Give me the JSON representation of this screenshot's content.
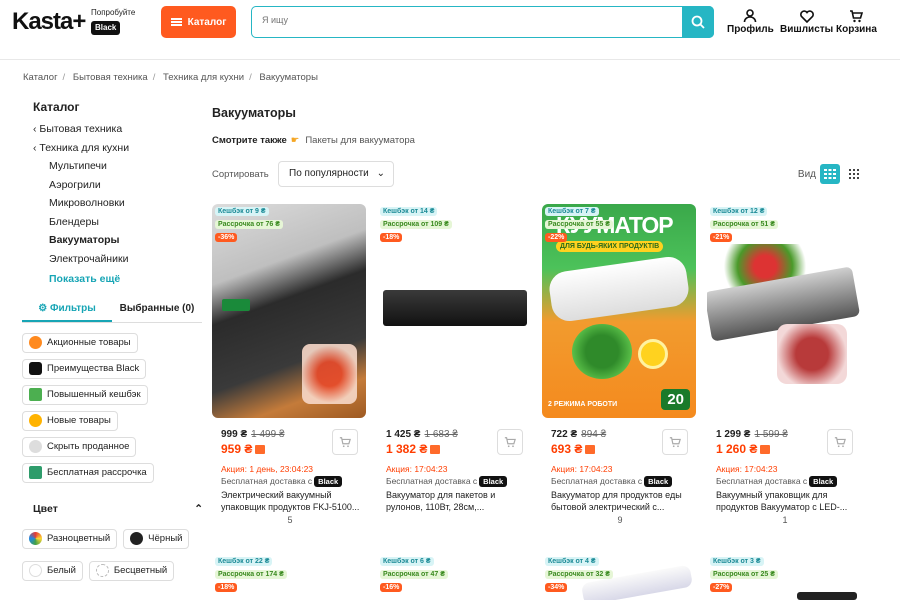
{
  "header": {
    "logo": "Kasta+",
    "promo_try": "Попробуйте",
    "promo_badge": "Black",
    "catalog_btn": "Каталог",
    "search_placeholder": "Я ищу",
    "profile": "Профиль",
    "wishlist": "Вишлисты",
    "cart": "Корзина",
    "accent": "#26b6c4",
    "orange": "#ff5a1f"
  },
  "breadcrumbs": [
    "Каталог",
    "Бытовая техника",
    "Техника для кухни",
    "Вакууматоры"
  ],
  "sidebar": {
    "title": "Каталог",
    "tree": [
      {
        "label": "Бытовая техника"
      },
      {
        "label": "Техника для кухни"
      }
    ],
    "children": [
      "Мультипечи",
      "Аэрогрили",
      "Микроволновки",
      "Блендеры",
      "Вакууматоры",
      "Электрочайники"
    ],
    "show_more": "Показать ещё",
    "tab_filters": "Фильтры",
    "tab_selected": "Выбранные (0)",
    "chips": [
      "Акционные товары",
      "Преимущества Black",
      "Повышенный кешбэк",
      "Новые товары",
      "Скрыть проданное",
      "Бесплатная рассрочка"
    ],
    "color_title": "Цвет",
    "colors": [
      "Разноцветный",
      "Чёрный",
      "Белый",
      "Бесцветный"
    ]
  },
  "main": {
    "title": "Вакууматоры",
    "see_also_label": "Смотрите также",
    "see_also_link": "Пакеты для вакууматора",
    "sort_label": "Сортировать",
    "sort_value": "По популярности",
    "view_label": "Вид"
  },
  "products": [
    {
      "cashback": "Кешбэк от 9 ₴",
      "installment": "Рассрочка от 76 ₴",
      "discount": "-36%",
      "old_price": "999 ₴",
      "old_strike": "1 499 ₴",
      "new_price": "959 ₴",
      "promo": "Акция: 1 день, 23:04:23",
      "delivery": "Бесплатная доставка с",
      "delivery_badge": "Black",
      "name": "Электрический вакуумный упаковщик продуктов FKJ-5100...",
      "reviews": "5"
    },
    {
      "cashback": "Кешбэк от 14 ₴",
      "installment": "Рассрочка от 109 ₴",
      "discount": "-18%",
      "old_price": "1 425 ₴",
      "old_strike": "1 683 ₴",
      "new_price": "1 382 ₴",
      "promo": "Акция: 17:04:23",
      "delivery": "Бесплатная доставка с",
      "delivery_badge": "Black",
      "name": "Вакууматор для пакетов и рулонов, 110Вт, 28см,...",
      "reviews": ""
    },
    {
      "cashback": "Кешбэк от 7 ₴",
      "installment": "Рассрочка от 55 ₴",
      "discount": "-22%",
      "old_price": "722 ₴",
      "old_strike": "894 ₴",
      "new_price": "693 ₴",
      "promo": "Акция: 17:04:23",
      "delivery": "Бесплатная доставка с",
      "delivery_badge": "Black",
      "name": "Вакууматор для продуктов еды бытовой электрический с...",
      "reviews": "9",
      "img_text": "КУУМАТОР",
      "img_sub": "ДЛЯ БУДЬ-ЯКИХ ПРОДУКТІВ",
      "img_count": "20",
      "img_left": "2 РЕЖИМА РОБОТИ"
    },
    {
      "cashback": "Кешбэк от 12 ₴",
      "installment": "Рассрочка от 51 ₴",
      "discount": "-21%",
      "old_price": "1 299 ₴",
      "old_strike": "1 599 ₴",
      "new_price": "1 260 ₴",
      "promo": "Акция: 17:04:23",
      "delivery": "Бесплатная доставка с",
      "delivery_badge": "Black",
      "name": "Вакуумный упаковщик для продуктов Вакууматор с LED-...",
      "reviews": "1"
    },
    {
      "cashback": "Кешбэк от 22 ₴",
      "installment": "Рассрочка от 174 ₴",
      "discount": "-18%"
    },
    {
      "cashback": "Кешбэк от 6 ₴",
      "installment": "Рассрочка от 47 ₴",
      "discount": "-16%"
    },
    {
      "cashback": "Кешбэк от 4 ₴",
      "installment": "Рассрочка от 32 ₴",
      "discount": "-34%"
    },
    {
      "cashback": "Кешбэк от 3 ₴",
      "installment": "Рассрочка от 25 ₴",
      "discount": "-27%"
    }
  ]
}
